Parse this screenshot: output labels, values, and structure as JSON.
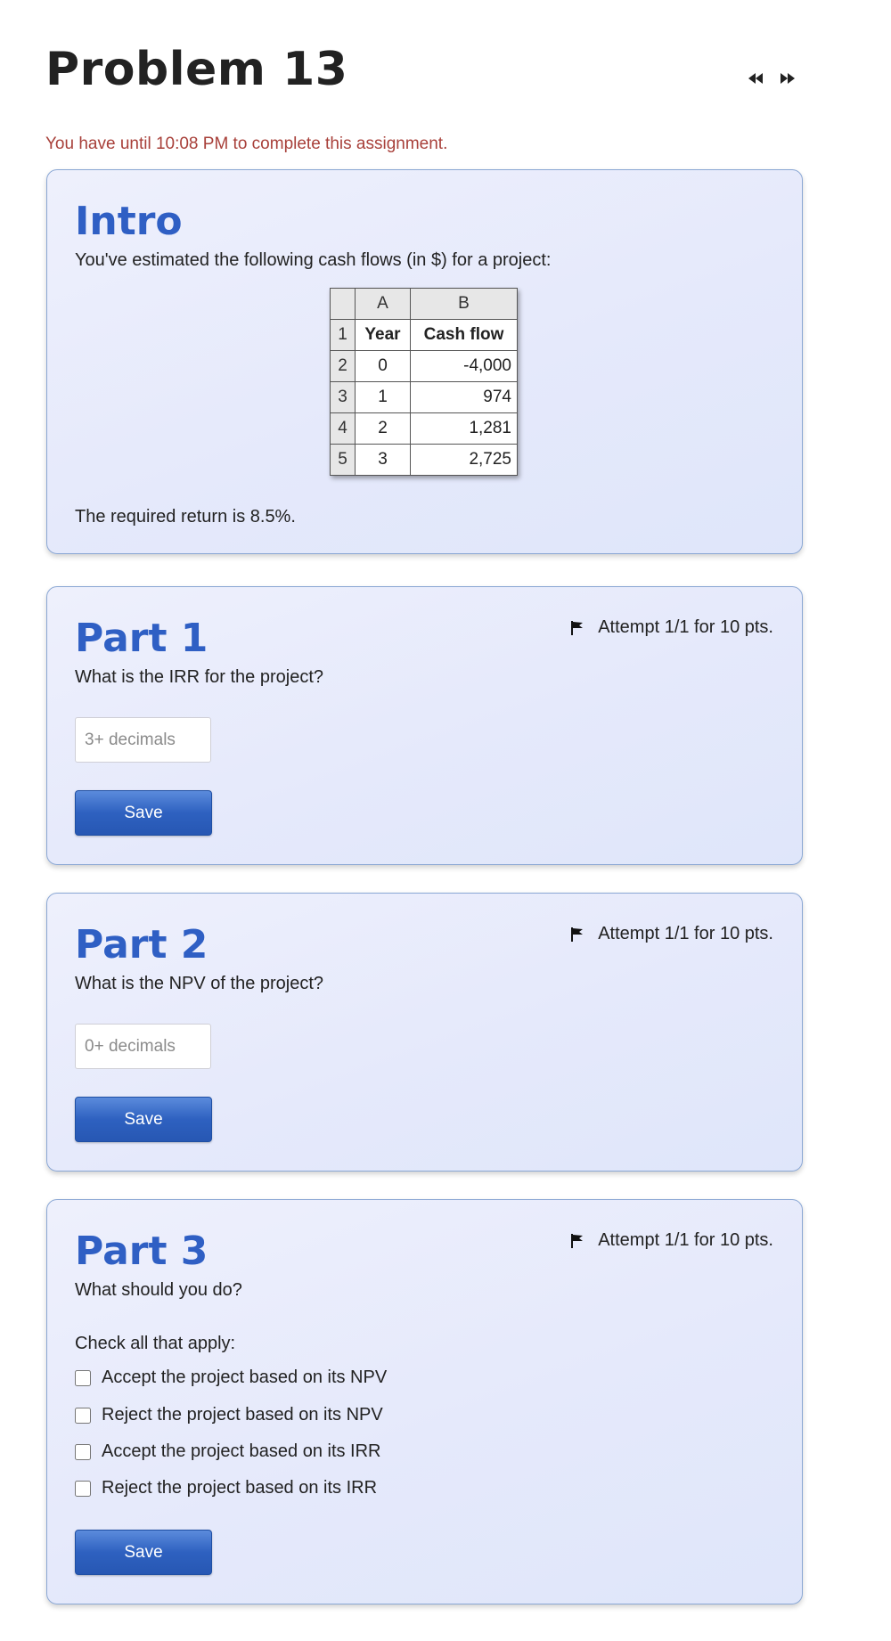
{
  "header": {
    "title": "Problem 13",
    "deadline": "You have until 10:08 PM to complete this assignment."
  },
  "intro": {
    "title": "Intro",
    "description": "You've estimated the following cash flows (in $) for a project:",
    "table": {
      "col_headers": [
        "A",
        "B"
      ],
      "rows": [
        {
          "num": "1",
          "a": "Year",
          "b": "Cash flow"
        },
        {
          "num": "2",
          "a": "0",
          "b": "-4,000"
        },
        {
          "num": "3",
          "a": "1",
          "b": "974"
        },
        {
          "num": "4",
          "a": "2",
          "b": "1,281"
        },
        {
          "num": "5",
          "a": "3",
          "b": "2,725"
        }
      ]
    },
    "footer": "The required return is 8.5%."
  },
  "parts": [
    {
      "title": "Part 1",
      "attempt": "Attempt 1/1 for 10 pts.",
      "question": "What is the IRR for the project?",
      "placeholder": "3+ decimals",
      "save_label": "Save"
    },
    {
      "title": "Part 2",
      "attempt": "Attempt 1/1 for 10 pts.",
      "question": "What is the NPV of the project?",
      "placeholder": "0+ decimals",
      "save_label": "Save"
    },
    {
      "title": "Part 3",
      "attempt": "Attempt 1/1 for 10 pts.",
      "question": "What should you do?",
      "instruction": "Check all that apply:",
      "options": [
        "Accept the project based on its NPV",
        "Reject the project based on its NPV",
        "Accept the project based on its IRR",
        "Reject the project based on its IRR"
      ],
      "save_label": "Save"
    }
  ],
  "icons": {
    "nav_prev": "rewind-icon",
    "nav_next": "fast-forward-icon",
    "flag": "flag-icon"
  },
  "colors": {
    "title_blue": "#2f5fc4",
    "deadline_red": "#a8403a",
    "button_blue": "#2e61c0",
    "card_border": "#8aa7d4"
  }
}
